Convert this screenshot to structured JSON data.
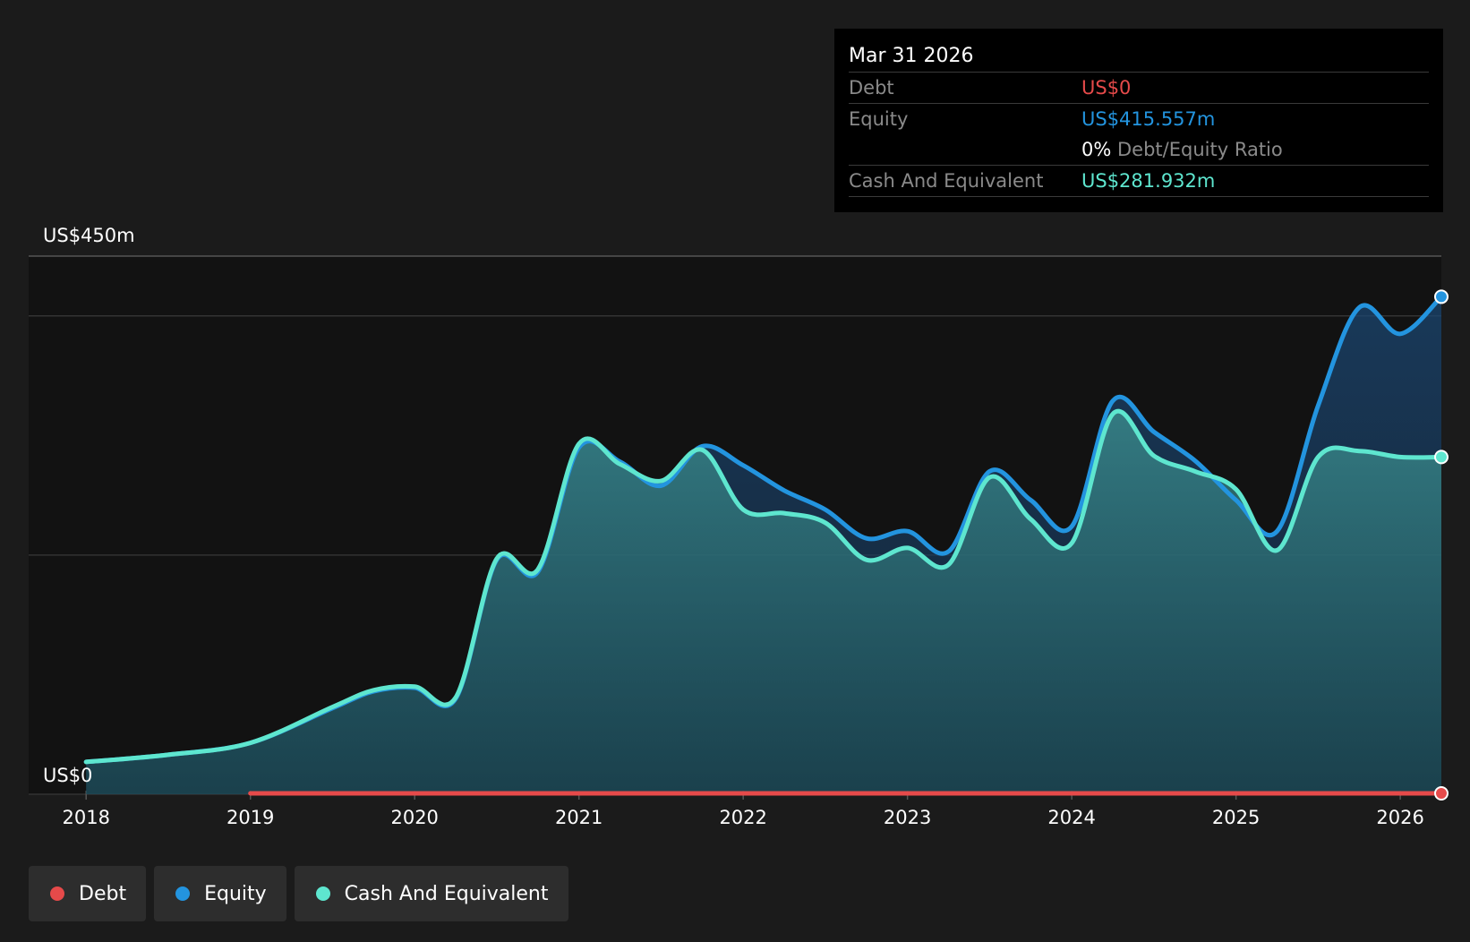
{
  "colors": {
    "background": "#1b1b1b",
    "plot_background": "#121212",
    "debt": "#e64a4a",
    "equity": "#2394df",
    "cash": "#5ee6cf",
    "grid": "#333333",
    "axis_text": "#ffffff"
  },
  "tooltip": {
    "date": "Mar 31 2026",
    "debt_label": "Debt",
    "debt_value": "US$0",
    "equity_label": "Equity",
    "equity_value": "US$415.557m",
    "ratio_value": "0%",
    "ratio_label": "Debt/Equity Ratio",
    "cash_label": "Cash And Equivalent",
    "cash_value": "US$281.932m"
  },
  "legend": [
    {
      "label": "Debt",
      "color": "#e64a4a"
    },
    {
      "label": "Equity",
      "color": "#2394df"
    },
    {
      "label": "Cash And Equivalent",
      "color": "#5ee6cf"
    }
  ],
  "chart_data": {
    "type": "area",
    "y_unit": "US$ m",
    "ylim": [
      0,
      450
    ],
    "xlim": [
      2017.65,
      2026.25
    ],
    "y_tick_labels": [
      {
        "value": 450,
        "label": "US$450m"
      },
      {
        "value": 0,
        "label": "US$0"
      }
    ],
    "gridlines": [
      0,
      200,
      400
    ],
    "x_ticks": [
      2018,
      2019,
      2020,
      2021,
      2022,
      2023,
      2024,
      2025,
      2026
    ],
    "x_tick_labels": [
      "2018",
      "2019",
      "2020",
      "2021",
      "2022",
      "2023",
      "2024",
      "2025",
      "2026"
    ],
    "grid": true,
    "legend_position": "bottom-left",
    "series": [
      {
        "name": "Debt",
        "color": "#e64a4a",
        "x": [
          2019.0,
          2026.25
        ],
        "y": [
          0,
          0
        ]
      },
      {
        "name": "Equity",
        "color": "#2394df",
        "x": [
          2018.0,
          2018.5,
          2019.0,
          2019.5,
          2019.75,
          2020.0,
          2020.25,
          2020.5,
          2020.75,
          2021.0,
          2021.25,
          2021.5,
          2021.75,
          2022.0,
          2022.25,
          2022.5,
          2022.75,
          2023.0,
          2023.25,
          2023.5,
          2023.75,
          2024.0,
          2024.25,
          2024.5,
          2024.75,
          2025.0,
          2025.25,
          2025.5,
          2025.75,
          2026.0,
          2026.25
        ],
        "y": [
          27,
          33,
          43,
          72,
          86,
          89,
          80,
          196,
          186,
          290,
          278,
          258,
          291,
          275,
          254,
          238,
          214,
          220,
          203,
          270,
          246,
          224,
          329,
          303,
          279,
          246,
          220,
          325,
          407,
          385,
          416
        ]
      },
      {
        "name": "Cash And Equivalent",
        "color": "#5ee6cf",
        "x": [
          2018.0,
          2018.5,
          2019.0,
          2019.5,
          2019.75,
          2020.0,
          2020.25,
          2020.5,
          2020.75,
          2021.0,
          2021.25,
          2021.5,
          2021.75,
          2022.0,
          2022.25,
          2022.5,
          2022.75,
          2023.0,
          2023.25,
          2023.5,
          2023.75,
          2024.0,
          2024.25,
          2024.5,
          2024.75,
          2025.0,
          2025.25,
          2025.5,
          2025.75,
          2026.0,
          2026.25
        ],
        "y": [
          27,
          33,
          43,
          73,
          87,
          90,
          81,
          197,
          188,
          293,
          276,
          262,
          288,
          238,
          235,
          227,
          196,
          206,
          192,
          265,
          230,
          210,
          318,
          283,
          270,
          255,
          204,
          282,
          287,
          282,
          282
        ]
      }
    ],
    "end_markers": true
  }
}
